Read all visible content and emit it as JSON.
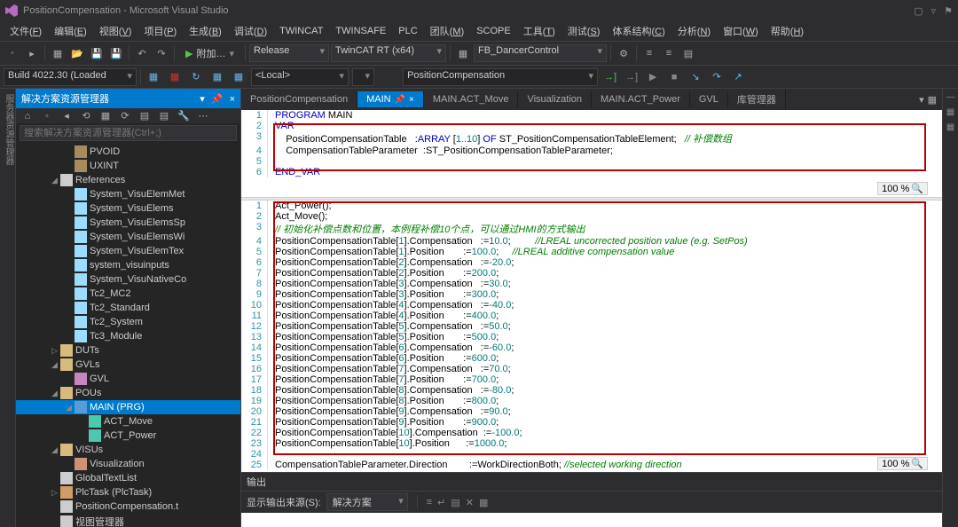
{
  "titlebar": {
    "title": "PositionCompensation - Microsoft Visual Studio"
  },
  "menubar": [
    "文件(<u>F</u>)",
    "编辑(<u>E</u>)",
    "视图(<u>V</u>)",
    "项目(<u>P</u>)",
    "生成(<u>B</u>)",
    "调试(<u>D</u>)",
    "TWINCAT",
    "TWINSAFE",
    "PLC",
    "团队(<u>M</u>)",
    "SCOPE",
    "工具(<u>T</u>)",
    "测试(<u>S</u>)",
    "体系结构(<u>C</u>)",
    "分析(<u>N</u>)",
    "窗口(<u>W</u>)",
    "帮助(<u>H</u>)"
  ],
  "toolbar": {
    "start": "附加…",
    "config": "Release",
    "platform": "TwinCAT RT (x64)",
    "launch": "FB_DancerControl"
  },
  "sub_toolbar": {
    "build": "Build 4022.30 (Loaded",
    "local": "<Local>",
    "target": "PositionCompensation"
  },
  "solution_panel": {
    "title": "解决方案资源管理器",
    "search_placeholder": "搜索解决方案资源管理器(Ctrl+;)",
    "tree": [
      {
        "indent": 3,
        "label": "PVOID",
        "icon": "type"
      },
      {
        "indent": 3,
        "label": "UXINT",
        "icon": "type"
      },
      {
        "indent": 2,
        "expand": "▢",
        "label": "References",
        "icon": "ref"
      },
      {
        "indent": 3,
        "label": "System_VisuElemMet",
        "icon": "lib"
      },
      {
        "indent": 3,
        "label": "System_VisuElems",
        "icon": "lib"
      },
      {
        "indent": 3,
        "label": "System_VisuElemsSp",
        "icon": "lib"
      },
      {
        "indent": 3,
        "label": "System_VisuElemsWi",
        "icon": "lib"
      },
      {
        "indent": 3,
        "label": "System_VisuElemTex",
        "icon": "lib"
      },
      {
        "indent": 3,
        "label": "system_visuinputs",
        "icon": "lib"
      },
      {
        "indent": 3,
        "label": "System_VisuNativeCo",
        "icon": "lib"
      },
      {
        "indent": 3,
        "label": "Tc2_MC2",
        "icon": "lib"
      },
      {
        "indent": 3,
        "label": "Tc2_Standard",
        "icon": "lib"
      },
      {
        "indent": 3,
        "label": "Tc2_System",
        "icon": "lib"
      },
      {
        "indent": 3,
        "label": "Tc3_Module",
        "icon": "lib"
      },
      {
        "indent": 2,
        "expand": "▷",
        "label": "DUTs",
        "icon": "folder"
      },
      {
        "indent": 2,
        "expand": "▢",
        "label": "GVLs",
        "icon": "folder"
      },
      {
        "indent": 3,
        "label": "GVL",
        "icon": "gvl"
      },
      {
        "indent": 2,
        "expand": "▢",
        "label": "POUs",
        "icon": "folder"
      },
      {
        "indent": 3,
        "expand": "▢",
        "label": "MAIN (PRG)",
        "icon": "pou",
        "selected": true
      },
      {
        "indent": 4,
        "label": "ACT_Move",
        "icon": "act"
      },
      {
        "indent": 4,
        "label": "ACT_Power",
        "icon": "act"
      },
      {
        "indent": 2,
        "expand": "▢",
        "label": "VISUs",
        "icon": "folder"
      },
      {
        "indent": 3,
        "label": "Visualization",
        "icon": "visu"
      },
      {
        "indent": 2,
        "label": "GlobalTextList",
        "icon": "txt"
      },
      {
        "indent": 2,
        "expand": "▷",
        "label": "PlcTask (PlcTask)",
        "icon": "task"
      },
      {
        "indent": 2,
        "label": "PositionCompensation.t",
        "icon": "file"
      },
      {
        "indent": 2,
        "label": "视图管理器",
        "icon": "mgr"
      }
    ]
  },
  "editor_tabs": [
    {
      "label": "PositionCompensation"
    },
    {
      "label": "MAIN",
      "active": true,
      "pinned": true
    },
    {
      "label": "MAIN.ACT_Move"
    },
    {
      "label": "Visualization"
    },
    {
      "label": "MAIN.ACT_Power"
    },
    {
      "label": "GVL"
    },
    {
      "label": "库管理器"
    }
  ],
  "top_code": [
    {
      "n": 1,
      "h": "<span class='kw'>PROGRAM</span> MAIN"
    },
    {
      "n": 2,
      "h": "<span class='kw'>VAR</span>"
    },
    {
      "n": 3,
      "h": "    PositionCompensationTable   :<span class='kw'>ARRAY</span> [<span class='teal'>1..10</span>] <span class='kw'>OF</span> ST_PositionCompensationTableElement;   <span class='cm'>// 补偿数组</span>"
    },
    {
      "n": 4,
      "h": "    CompensationTableParameter  :ST_PositionCompensationTableParameter;"
    },
    {
      "n": 5,
      "h": ""
    },
    {
      "n": 6,
      "h": "<span class='kw'>END_VAR</span>"
    }
  ],
  "bottom_code": [
    {
      "n": 1,
      "h": "Act_Power();"
    },
    {
      "n": 2,
      "h": "Act_Move();"
    },
    {
      "n": 3,
      "h": "<span class='cm'>// 初始化补偿点数和位置，本例程补偿10个点，可以通过HMI的方式输出</span>"
    },
    {
      "n": 4,
      "h": "PositionCompensationTable[<span class='teal'>1</span>].Compensation   :=<span class='teal'>10.0</span>;         <span class='cm'>//LREAL uncorrected position value (e.g. SetPos)</span>"
    },
    {
      "n": 5,
      "h": "PositionCompensationTable[<span class='teal'>1</span>].Position       :=<span class='teal'>100.0</span>;     <span class='cm'>//LREAL additive compensation value</span>"
    },
    {
      "n": 6,
      "h": "PositionCompensationTable[<span class='teal'>2</span>].Compensation   :=<span class='teal'>-20.0</span>;"
    },
    {
      "n": 7,
      "h": "PositionCompensationTable[<span class='teal'>2</span>].Position       :=<span class='teal'>200.0</span>;"
    },
    {
      "n": 8,
      "h": "PositionCompensationTable[<span class='teal'>3</span>].Compensation   :=<span class='teal'>30.0</span>;"
    },
    {
      "n": 9,
      "h": "PositionCompensationTable[<span class='teal'>3</span>].Position       :=<span class='teal'>300.0</span>;"
    },
    {
      "n": 10,
      "h": "PositionCompensationTable[<span class='teal'>4</span>].Compensation   :=<span class='teal'>-40.0</span>;"
    },
    {
      "n": 11,
      "h": "PositionCompensationTable[<span class='teal'>4</span>].Position       :=<span class='teal'>400.0</span>;"
    },
    {
      "n": 12,
      "h": "PositionCompensationTable[<span class='teal'>5</span>].Compensation   :=<span class='teal'>50.0</span>;"
    },
    {
      "n": 13,
      "h": "PositionCompensationTable[<span class='teal'>5</span>].Position       :=<span class='teal'>500.0</span>;"
    },
    {
      "n": 14,
      "h": "PositionCompensationTable[<span class='teal'>6</span>].Compensation   :=<span class='teal'>-60.0</span>;"
    },
    {
      "n": 15,
      "h": "PositionCompensationTable[<span class='teal'>6</span>].Position       :=<span class='teal'>600.0</span>;"
    },
    {
      "n": 16,
      "h": "PositionCompensationTable[<span class='teal'>7</span>].Compensation   :=<span class='teal'>70.0</span>;"
    },
    {
      "n": 17,
      "h": "PositionCompensationTable[<span class='teal'>7</span>].Position       :=<span class='teal'>700.0</span>;"
    },
    {
      "n": 18,
      "h": "PositionCompensationTable[<span class='teal'>8</span>].Compensation   :=<span class='teal'>-80.0</span>;"
    },
    {
      "n": 19,
      "h": "PositionCompensationTable[<span class='teal'>8</span>].Position       :=<span class='teal'>800.0</span>;"
    },
    {
      "n": 20,
      "h": "PositionCompensationTable[<span class='teal'>9</span>].Compensation   :=<span class='teal'>90.0</span>;"
    },
    {
      "n": 21,
      "h": "PositionCompensationTable[<span class='teal'>9</span>].Position       :=<span class='teal'>900.0</span>;"
    },
    {
      "n": 22,
      "h": "PositionCompensationTable[<span class='teal'>10</span>].Compensation  :=<span class='teal'>-100.0</span>;"
    },
    {
      "n": 23,
      "h": "PositionCompensationTable[<span class='teal'>10</span>].Position      :=<span class='teal'>1000.0</span>;"
    },
    {
      "n": 24,
      "h": ""
    },
    {
      "n": 25,
      "h": "CompensationTableParameter.Direction        :=WorkDirectionBoth; <span class='cm'>//selected working direction</span>"
    }
  ],
  "zoom": "100 %",
  "output": {
    "title": "输出",
    "source_label": "显示输出来源(S):",
    "source_value": "解决方案"
  }
}
